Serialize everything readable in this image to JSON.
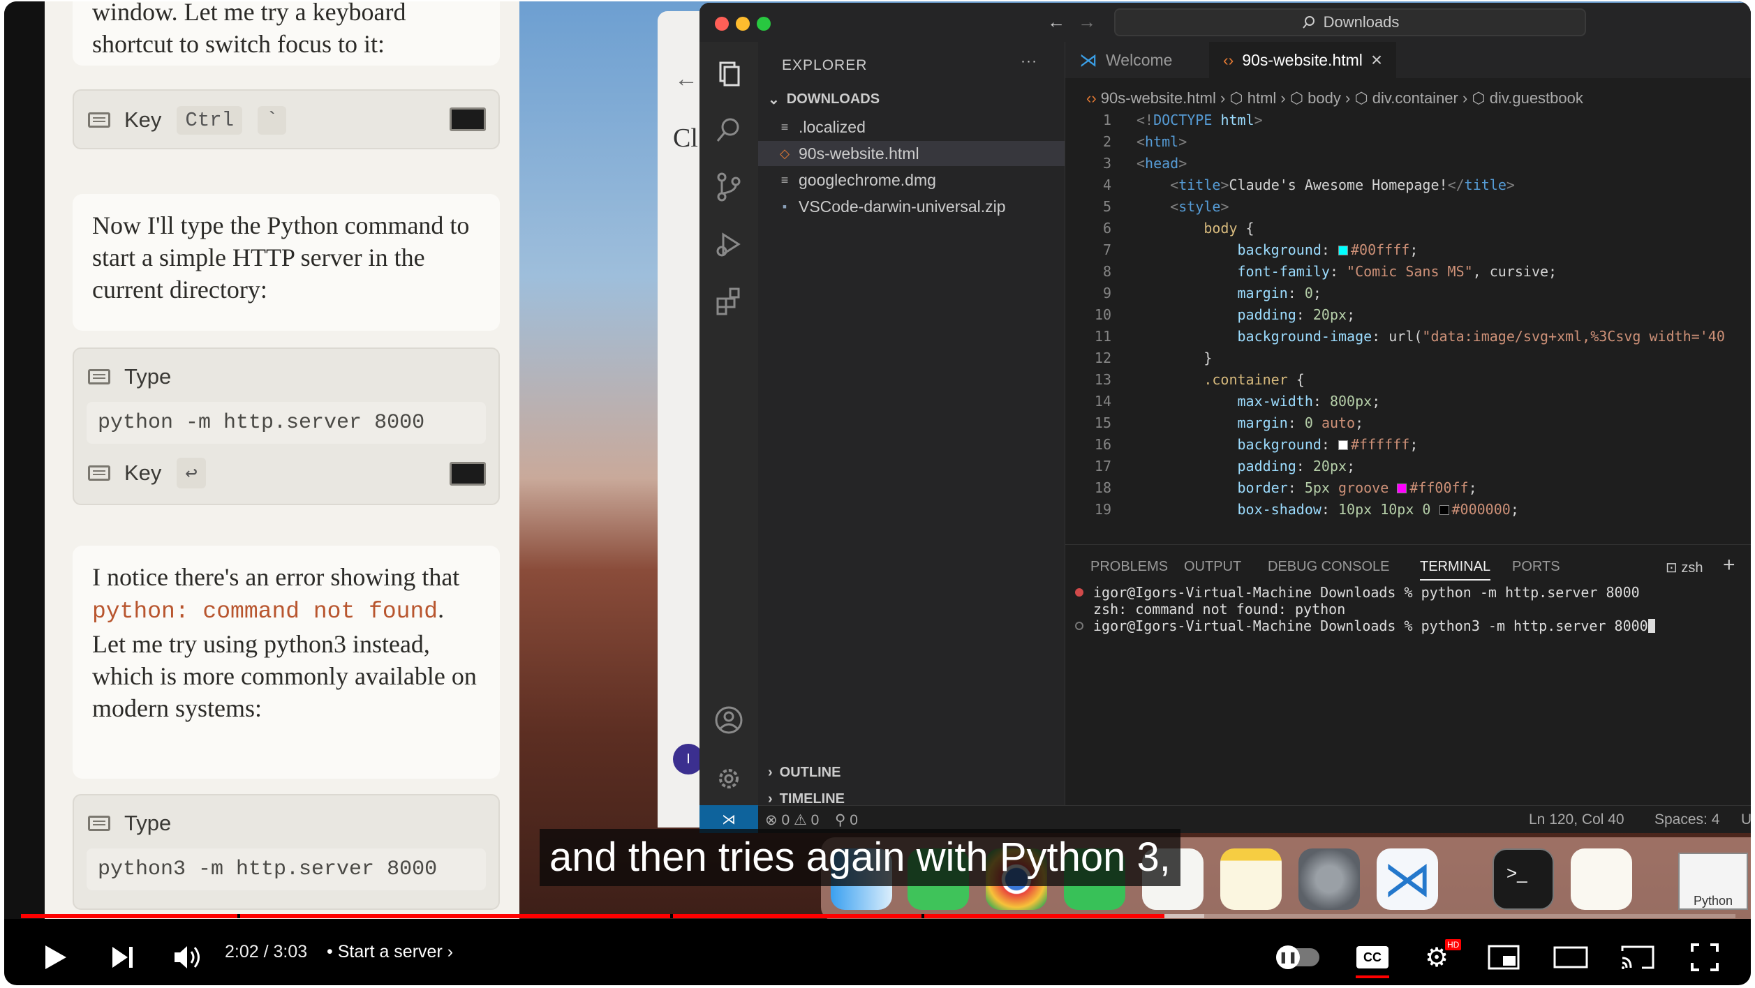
{
  "chat": {
    "msg0_text": "window. Let me try a keyboard shortcut to switch focus to it:",
    "action_key1": {
      "label": "Key",
      "keys": [
        "Ctrl",
        "`"
      ]
    },
    "msg1_text": "Now I'll type the Python command to start a simple HTTP server in the current directory:",
    "action_type1": {
      "label": "Type",
      "command": "python -m http.server 8000"
    },
    "action_key2": {
      "label": "Key",
      "key": "↩"
    },
    "msg2_part1": "I notice there's an error showing that ",
    "msg2_code": "python: command not found",
    "msg2_part2": ". Let me try using python3 instead, which is more commonly available on modern systems:",
    "action_type2": {
      "label": "Type",
      "command": "python3 -m http.server 8000"
    }
  },
  "browser": {
    "back": "←",
    "partial_title": "Cl",
    "avatar_letter": "I"
  },
  "vscode": {
    "command_center": "Downloads",
    "explorer": {
      "title": "EXPLORER",
      "more": "···",
      "folder": "DOWNLOADS",
      "files": [
        ".localized",
        "90s-website.html",
        "googlechrome.dmg",
        "VSCode-darwin-universal.zip"
      ],
      "outline": "OUTLINE",
      "timeline": "TIMELINE"
    },
    "tabs": [
      {
        "label": "Welcome"
      },
      {
        "label": "90s-website.html"
      }
    ],
    "breadcrumb": [
      "90s-website.html",
      "html",
      "body",
      "div.container",
      "div.guestbook"
    ],
    "code_lines": [
      "1",
      "2",
      "3",
      "4",
      "5",
      "6",
      "7",
      "8",
      "9",
      "10",
      "11",
      "12",
      "13",
      "14",
      "15",
      "16",
      "17",
      "18",
      "19"
    ],
    "panel_tabs": [
      "PROBLEMS",
      "OUTPUT",
      "DEBUG CONSOLE",
      "TERMINAL",
      "PORTS"
    ],
    "shell": "zsh",
    "terminal": [
      "igor@Igors-Virtual-Machine Downloads % python -m http.server 8000",
      "zsh: command not found: python",
      "igor@Igors-Virtual-Machine Downloads % python3 -m http.server 8000"
    ],
    "status": {
      "errors": "0",
      "warnings": "0",
      "ports": "0",
      "position": "Ln 120, Col 40",
      "spaces": "Spaces: 4",
      "encoding": "U"
    }
  },
  "dock": {
    "preview_label": "Python"
  },
  "subtitle": "and then tries again with Python 3,",
  "player": {
    "time": "2:02 / 3:03",
    "separator": "•",
    "chapter": "Start a server",
    "progress_fraction": 0.667,
    "buffered_fraction": 0.69,
    "hd_badge": "HD",
    "colors": {
      "progress": "#ff0000",
      "cc_underline": "#ff0000"
    }
  }
}
